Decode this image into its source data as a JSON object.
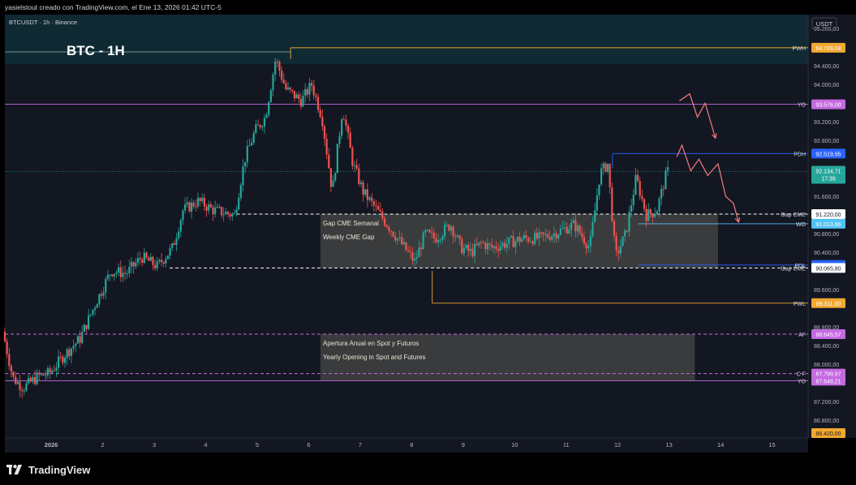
{
  "header": {
    "author_line": "yasielstout creado con TradingView.com, el Ene 13, 2026 01:42 UTC-5",
    "symbol_line": "BTCUSDT · 1h · Binance",
    "big_title": "BTC - 1H",
    "currency": "USDT"
  },
  "footer": {
    "brand": "TradingView"
  },
  "colors": {
    "background": "#131722",
    "up_candle": "#26a69a",
    "down_candle": "#ef5350",
    "pwh": "#f0a830",
    "yo": "#c56ae0",
    "pdh": "#2962ff",
    "gap": "#ffffff",
    "wo": "#4fc3f7",
    "pwl": "#f0a830",
    "af": "#c56ae0",
    "arrow": "#f77c80"
  },
  "chart_data": {
    "type": "candlestick",
    "title": "BTC - 1H",
    "y_unit": "USDT",
    "ylim": [
      86420,
      95500
    ],
    "xlim": [
      0.1,
      15.7
    ],
    "y_ticks": [
      "95.200,00",
      "94.400,00",
      "94.000,00",
      "93.200,00",
      "92.800,00",
      "91.600,00",
      "90.800,00",
      "90.400,00",
      "89.600,00",
      "88.800,00",
      "88.400,00",
      "88.000,00",
      "87.200,00",
      "86.800,00"
    ],
    "y_tick_values": [
      95200,
      94400,
      94000,
      93200,
      92800,
      91600,
      90800,
      90400,
      89600,
      88800,
      88400,
      88000,
      87200,
      86800
    ],
    "x_ticks": [
      {
        "label": "2026",
        "x": 1
      },
      {
        "label": "2",
        "x": 2
      },
      {
        "label": "3",
        "x": 3
      },
      {
        "label": "4",
        "x": 4
      },
      {
        "label": "5",
        "x": 5
      },
      {
        "label": "6",
        "x": 6
      },
      {
        "label": "7",
        "x": 7
      },
      {
        "label": "8",
        "x": 8
      },
      {
        "label": "9",
        "x": 9
      },
      {
        "label": "10",
        "x": 10
      },
      {
        "label": "11",
        "x": 11
      },
      {
        "label": "12",
        "x": 12
      },
      {
        "label": "13",
        "x": 13
      },
      {
        "label": "14",
        "x": 14
      },
      {
        "label": "15",
        "x": 15
      }
    ],
    "price_path": [
      [
        0.1,
        88700
      ],
      [
        0.3,
        87700
      ],
      [
        0.5,
        87500
      ],
      [
        0.8,
        87750
      ],
      [
        1.0,
        87800
      ],
      [
        1.3,
        88200
      ],
      [
        1.6,
        88550
      ],
      [
        1.9,
        89300
      ],
      [
        2.2,
        90000
      ],
      [
        2.5,
        89950
      ],
      [
        2.8,
        90300
      ],
      [
        3.1,
        90100
      ],
      [
        3.4,
        90500
      ],
      [
        3.6,
        91300
      ],
      [
        3.9,
        91500
      ],
      [
        4.2,
        91300
      ],
      [
        4.4,
        91250
      ],
      [
        4.6,
        91200
      ],
      [
        4.8,
        92400
      ],
      [
        5.0,
        93000
      ],
      [
        5.2,
        93300
      ],
      [
        5.4,
        94550
      ],
      [
        5.6,
        93900
      ],
      [
        5.9,
        93650
      ],
      [
        6.1,
        94000
      ],
      [
        6.3,
        93300
      ],
      [
        6.5,
        91700
      ],
      [
        6.7,
        93500
      ],
      [
        6.9,
        92300
      ],
      [
        7.1,
        91700
      ],
      [
        7.3,
        91400
      ],
      [
        7.5,
        91100
      ],
      [
        7.7,
        90800
      ],
      [
        7.9,
        90500
      ],
      [
        8.1,
        90200
      ],
      [
        8.3,
        90800
      ],
      [
        8.5,
        90700
      ],
      [
        8.8,
        91000
      ],
      [
        9.0,
        90500
      ],
      [
        9.2,
        90400
      ],
      [
        9.4,
        90600
      ],
      [
        9.6,
        90500
      ],
      [
        9.9,
        90600
      ],
      [
        10.2,
        90700
      ],
      [
        10.5,
        90700
      ],
      [
        10.8,
        90800
      ],
      [
        11.0,
        90900
      ],
      [
        11.2,
        91000
      ],
      [
        11.5,
        90500
      ],
      [
        11.7,
        92100
      ],
      [
        11.85,
        92300
      ],
      [
        12.0,
        90300
      ],
      [
        12.2,
        90800
      ],
      [
        12.4,
        92000
      ],
      [
        12.6,
        91200
      ],
      [
        12.8,
        91300
      ],
      [
        13.0,
        92134
      ]
    ],
    "last_price": {
      "value": 92134.71,
      "label": "92.134,71",
      "countdown": "17:39"
    },
    "levels": [
      {
        "tag": "PWH",
        "label": "94.789,08",
        "value": 94789.08,
        "style": "solid",
        "color_key": "pwh",
        "x_start": 5.65
      },
      {
        "tag": "YO",
        "label": "93.576,00",
        "value": 93576,
        "style": "solid",
        "color_key": "yo",
        "x_start": 0.1
      },
      {
        "tag": "PDH",
        "label": "92.519,95",
        "value": 92519.95,
        "style": "solid",
        "color_key": "pdh",
        "x_start": 11.9
      },
      {
        "tag": "Gap CME",
        "label": "91.220,00",
        "value": 91220,
        "style": "dashed",
        "color_key": "gap",
        "x_start": 4.6
      },
      {
        "tag": "WO",
        "label": "91.013,66",
        "value": 91013.66,
        "style": "solid",
        "color_key": "wo",
        "x_start": 12.4
      },
      {
        "tag": "PDL",
        "label": "90.128,44",
        "value": 90128.44,
        "style": "solid",
        "color_key": "pdh",
        "x_start": 12.4
      },
      {
        "tag": "Gap CME",
        "label": "90.065,80",
        "value": 90065.8,
        "style": "dashed",
        "color_key": "gap",
        "x_start": 3.3
      },
      {
        "tag": "PWL",
        "label": "89.311,00",
        "value": 89311,
        "style": "solid",
        "color_key": "pwl",
        "x_start": 8.4
      },
      {
        "tag": "AF",
        "label": "88.645,57",
        "value": 88645.57,
        "style": "dashed",
        "color_key": "af",
        "x_start": 0.1
      },
      {
        "tag": "C F",
        "label": "87.799,97",
        "value": 87799.97,
        "style": "dashed",
        "color_key": "af",
        "x_start": 0.1
      },
      {
        "tag": "YO",
        "label": "87.648,21",
        "value": 87648.21,
        "style": "solid",
        "color_key": "yo",
        "x_start": 0.1
      }
    ],
    "bottom_price": {
      "label": "86.420,00",
      "value": 86420
    },
    "zones": [
      {
        "x0": 6.23,
        "x1": 13.95,
        "y0": 90065.8,
        "y1": 91220,
        "line1": "Gap CME Semanal",
        "line2": "Weekly CME Gap"
      },
      {
        "x0": 6.23,
        "x1": 13.5,
        "y0": 87648.21,
        "y1": 88645.57,
        "line1": "Apertura Anual en Spot y Futuros",
        "line2": "Yearly Opening in Spot and Futures"
      }
    ],
    "projections": [
      [
        [
          13.2,
          93650
        ],
        [
          13.4,
          93800
        ],
        [
          13.55,
          93300
        ],
        [
          13.7,
          93600
        ],
        [
          13.9,
          92850
        ]
      ],
      [
        [
          13.15,
          92450
        ],
        [
          13.25,
          92700
        ],
        [
          13.42,
          92150
        ],
        [
          13.58,
          92400
        ],
        [
          13.75,
          92050
        ],
        [
          13.95,
          92300
        ],
        [
          14.1,
          91600
        ],
        [
          14.25,
          91450
        ],
        [
          14.35,
          91050
        ]
      ]
    ]
  }
}
